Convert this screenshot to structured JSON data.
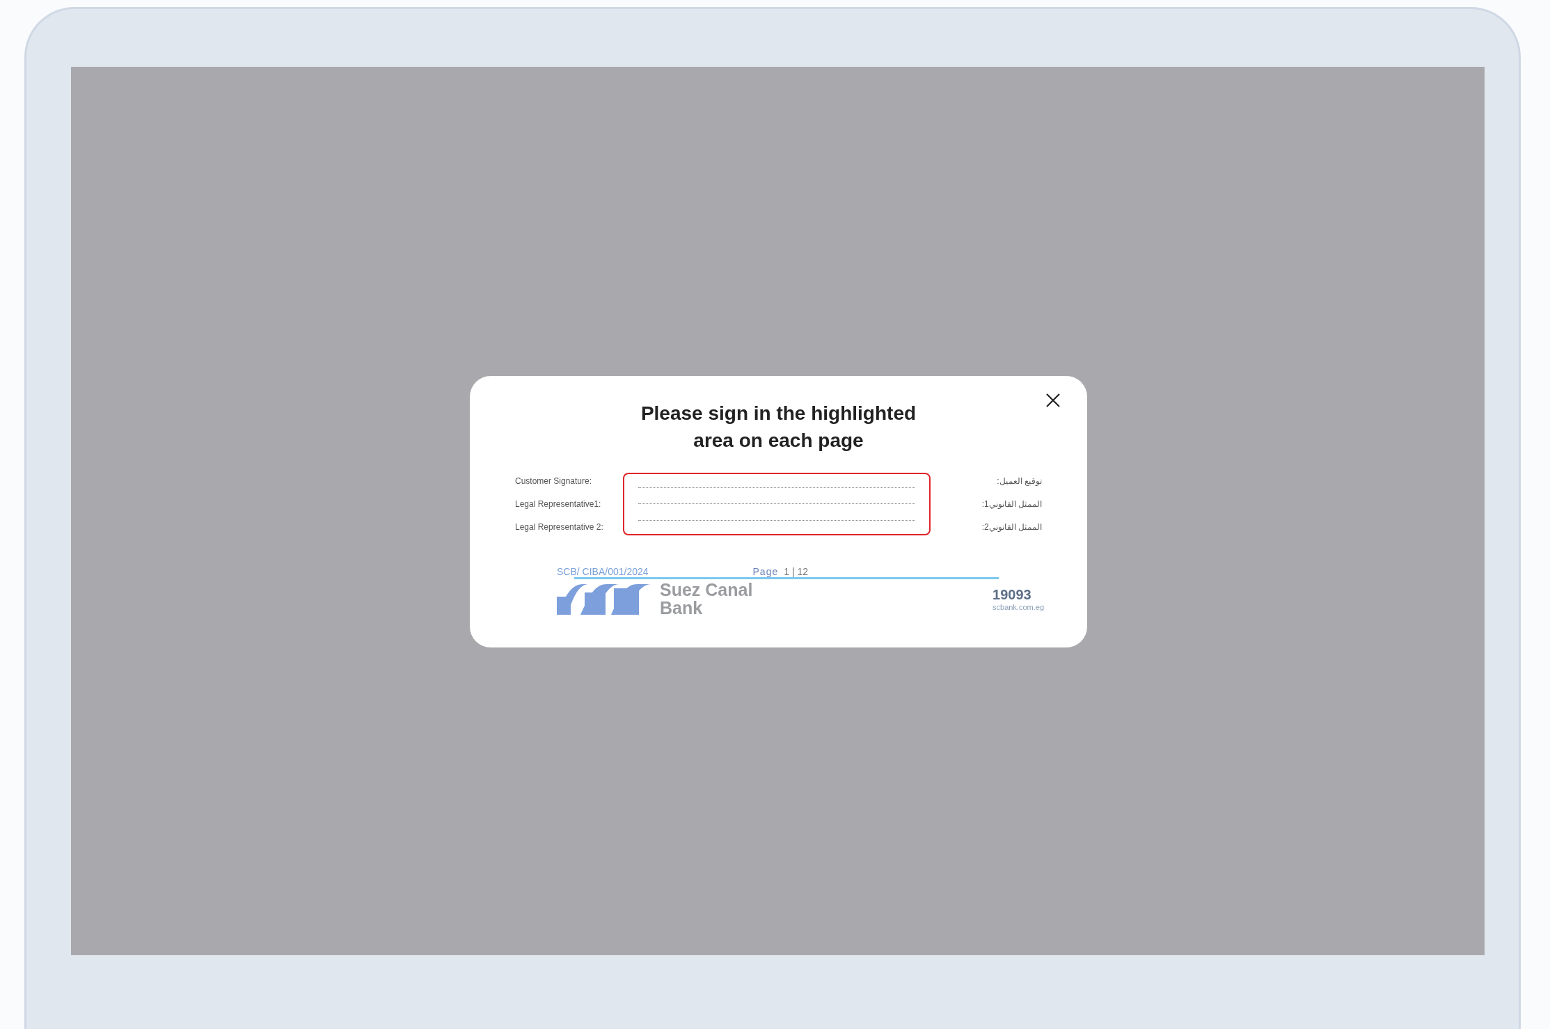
{
  "dialog": {
    "title": "Please sign in the highlighted area on each page",
    "document": {
      "rows": [
        {
          "label": "Customer Signature:",
          "label_ar": "توقيع العميل:"
        },
        {
          "label": "Legal Representative1:",
          "label_ar": "الممثل القانوني1:"
        },
        {
          "label": "Legal Representative 2:",
          "label_ar": "الممثل القانوني2:"
        }
      ],
      "reference": "SCB/ CIBA/001/2024",
      "page_label": "Page",
      "page_number": "1 | 12",
      "brand_line_1": "Suez Canal",
      "brand_line_2": "Bank",
      "hotline": "19093",
      "website": "scbank.com.eg"
    }
  }
}
